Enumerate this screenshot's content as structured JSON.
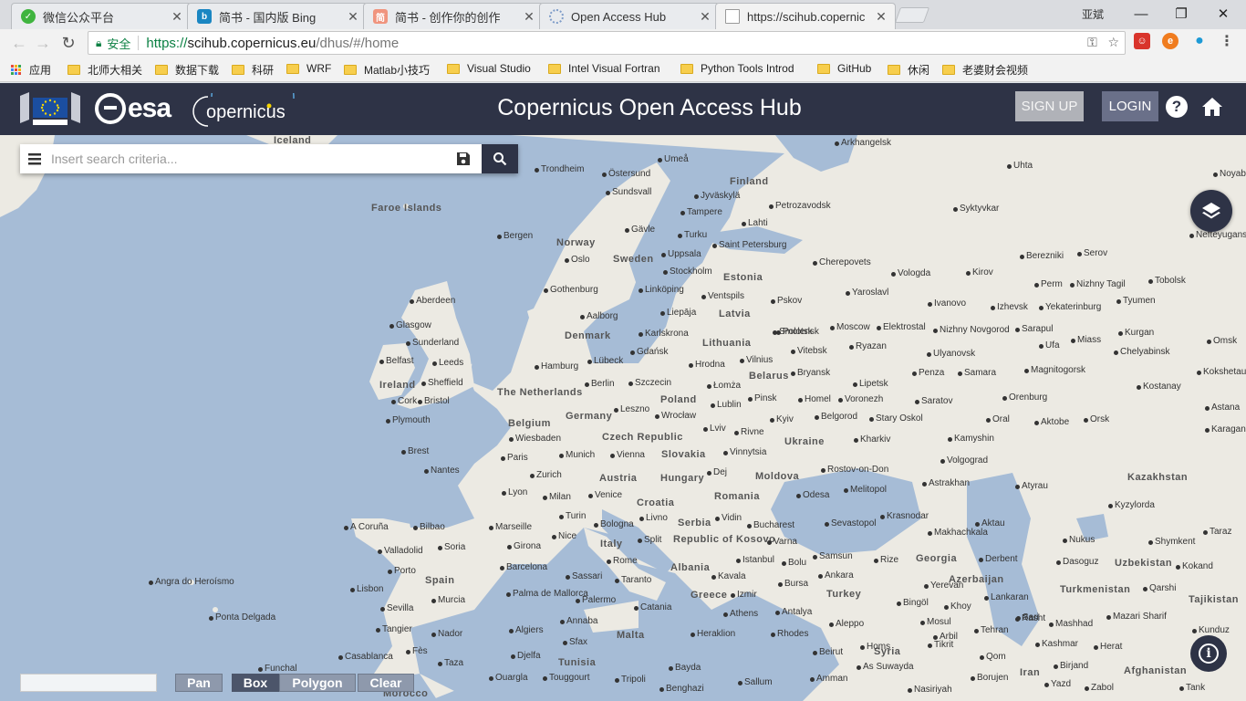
{
  "browser": {
    "tabs": [
      {
        "label": "微信公众平台",
        "icon": "wechat-icon",
        "color": "#3fb43f"
      },
      {
        "label": "简书 - 国内版 Bing",
        "icon": "bing-icon",
        "color": "#1a86c2"
      },
      {
        "label": "简书 - 创作你的创作",
        "icon": "jianshu-icon",
        "color": "#f0947e"
      },
      {
        "label": "Open Access Hub",
        "icon": "globe-icon",
        "color": "#9ab4d8"
      },
      {
        "label": "https://scihub.copernic",
        "icon": "page-icon",
        "color": "#ffffff"
      }
    ],
    "window_user": "亚斌",
    "address": {
      "secure_label": "安全",
      "protocol": "https://",
      "host": "scihub.copernicus.eu",
      "path": "/dhus/#/home"
    },
    "bookmarks": [
      {
        "label": "应用",
        "type": "apps"
      },
      {
        "label": "北师大相关",
        "type": "folder"
      },
      {
        "label": "数据下载",
        "type": "folder"
      },
      {
        "label": "科研",
        "type": "folder"
      },
      {
        "label": "WRF",
        "type": "folder"
      },
      {
        "label": "Matlab小技巧",
        "type": "folder"
      },
      {
        "label": "Visual Studio",
        "type": "folder"
      },
      {
        "label": "Intel Visual Fortran",
        "type": "folder"
      },
      {
        "label": "Python Tools Introd",
        "type": "folder"
      },
      {
        "label": "GitHub",
        "type": "folder"
      },
      {
        "label": "休闲",
        "type": "folder"
      },
      {
        "label": "老婆财会视频",
        "type": "folder"
      }
    ]
  },
  "header": {
    "esa_text": "esa",
    "copernicus_text": "opernicus",
    "title": "Copernicus Open Access Hub",
    "signup_label": "SIGN UP",
    "login_label": "LOGIN"
  },
  "search": {
    "placeholder": "Insert search criteria..."
  },
  "map_tools": {
    "pan_label": "Pan",
    "box_label": "Box",
    "polygon_label": "Polygon",
    "clear_label": "Clear"
  },
  "map": {
    "countries": [
      "Iceland",
      "Faroe Islands",
      "Norway",
      "Sweden",
      "Finland",
      "Estonia",
      "Latvia",
      "Lithuania",
      "Denmark",
      "Ireland",
      "The Netherlands",
      "Belgium",
      "Germany",
      "Poland",
      "Belarus",
      "Czech Republic",
      "Slovakia",
      "Ukraine",
      "Austria",
      "Hungary",
      "Moldova",
      "Romania",
      "Croatia",
      "Serbia",
      "Republic of Kosovo",
      "Italy",
      "Albania",
      "Greece",
      "Turkey",
      "Spain",
      "Georgia",
      "Azerbaijan",
      "Kazakhstan",
      "Uzbekistan",
      "Turkmenistan",
      "Tajikistan",
      "Syria",
      "Tunisia",
      "Malta",
      "Iran",
      "Afghanistan",
      "Morocco"
    ],
    "cities": [
      "Arkhangelsk",
      "Umeå",
      "Trondheim",
      "Östersund",
      "Sundsvall",
      "Jyväskylä",
      "Tampere",
      "Petrozavodsk",
      "Gävle",
      "Lahti",
      "Turku",
      "Bergen",
      "Uppsala",
      "Saint Petersburg",
      "Oslo",
      "Stockholm",
      "Gothenburg",
      "Linköping",
      "Ventspils",
      "Pskov",
      "Aalborg",
      "Liepāja",
      "Karlskrona",
      "Gdańsk",
      "Vilnius",
      "Aberdeen",
      "Glasgow",
      "Sunderland",
      "Belfast",
      "Leeds",
      "Sheffield",
      "Cork",
      "Bristol",
      "Plymouth",
      "Hamburg",
      "Lübeck",
      "Berlin",
      "Szczecin",
      "Hrodna",
      "Łomża",
      "Lublin",
      "Pinsk",
      "Leszno",
      "Wrocław",
      "Lviv",
      "Rivne",
      "Kyiv",
      "Brest",
      "Wiesbaden",
      "Paris",
      "Nantes",
      "Munich",
      "Vienna",
      "Zurich",
      "Lyon",
      "Milan",
      "Venice",
      "Dej",
      "Vinnytsia",
      "Rostov-on-Don",
      "Melitopol",
      "Odesa",
      "Krasnodar",
      "Turin",
      "Bologna",
      "Livno",
      "Vidin",
      "Bucharest",
      "Sevastopol",
      "Varna",
      "A Coruña",
      "Bilbao",
      "Marseille",
      "Nice",
      "Valladolid",
      "Soria",
      "Girona",
      "Split",
      "Istanbul",
      "Bolu",
      "Samsun",
      "Rize",
      "Porto",
      "Barcelona",
      "Sassari",
      "Rome",
      "Taranto",
      "Kavala",
      "Bursa",
      "Ankara",
      "Lisbon",
      "Murcia",
      "Palma de Mallorca",
      "Palermo",
      "Catania",
      "Izmir",
      "Athens",
      "Antalya",
      "Sevilla",
      "Tangier",
      "Nador",
      "Annaba",
      "Algiers",
      "Sfax",
      "Heraklion",
      "Rhodes",
      "Casablanca",
      "Fès",
      "Djelfa",
      "Taza",
      "Ouargla",
      "Touggourt",
      "Tripoli",
      "Bayda",
      "Benghazi",
      "Sallum",
      "Amman",
      "Beirut",
      "Funchal",
      "Angra do Heroísmo",
      "Ponta Delgada",
      "Moscow",
      "Elektrostal",
      "Yaroslavl",
      "Ivanovo",
      "Vologda",
      "Cherepovets",
      "Kirov",
      "Syktyvkar",
      "Perm",
      "Nizhny Tagil",
      "Yekaterinburg",
      "Izhevsk",
      "Tyumen",
      "Tobolsk",
      "Ufa",
      "Chelyabinsk",
      "Miass",
      "Kurgan",
      "Sarapul",
      "Nizhny Novgorod",
      "Ryazan",
      "Ulyanovsk",
      "Samara",
      "Penza",
      "Magnitogorsk",
      "Orenburg",
      "Saratov",
      "Voronezh",
      "Lipetsk",
      "Stary Oskol",
      "Belgorod",
      "Kharkiv",
      "Kamyshin",
      "Volgograd",
      "Astrakhan",
      "Atyrau",
      "Aktau",
      "Oral",
      "Aktobe",
      "Orsk",
      "Astana",
      "Karaganda",
      "Kostanay",
      "Kokshetau",
      "Omsk",
      "Nefteyugansk",
      "Noyabrsk",
      "Uhta",
      "Berezniki",
      "Serov",
      "Smolensk",
      "Polotsk",
      "Vitebsk",
      "Bryansk",
      "Homel",
      "Makhachkala",
      "Derbent",
      "Lankaran",
      "Yerevan",
      "Bingöl",
      "Khoy",
      "Rasht",
      "Tehran",
      "Sari",
      "Mashhad",
      "Kashmar",
      "Herat",
      "Mazari Sharif",
      "Kunduz",
      "Dasoguz",
      "Nukus",
      "Shymkent",
      "Taraz",
      "Kokand",
      "Qarshi",
      "Kyzylorda",
      "Qom",
      "Birjand",
      "Zabol",
      "Nasiriyah",
      "Borujen",
      "Yazd",
      "Tank",
      "Arbil",
      "Mosul",
      "Tikrit",
      "As Suwayda",
      "Aleppo",
      "Homs"
    ]
  }
}
